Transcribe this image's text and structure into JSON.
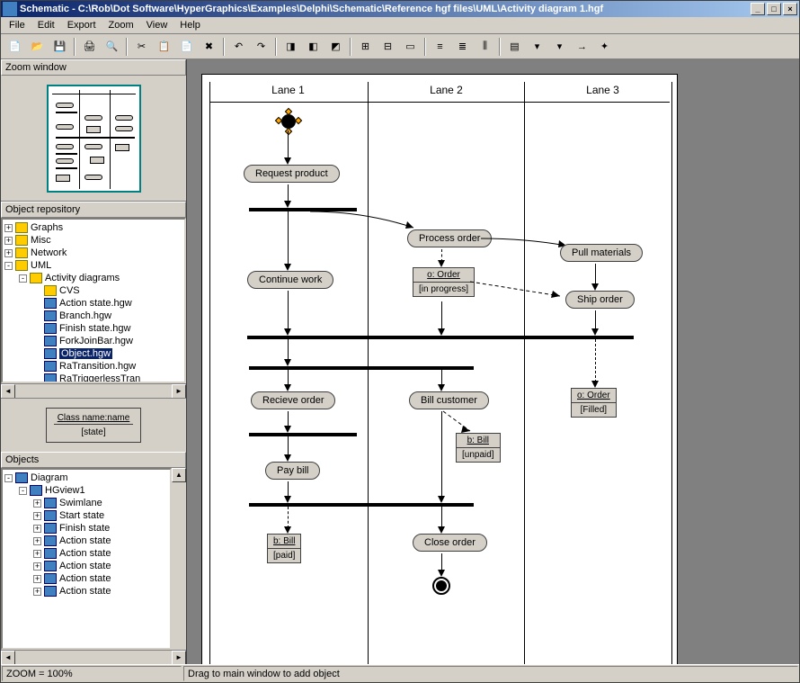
{
  "window": {
    "title": "Schematic - C:\\Rob\\Dot Software\\HyperGraphics\\Examples\\Delphi\\Schematic\\Reference hgf files\\UML\\Activity diagram 1.hgf"
  },
  "menubar": {
    "items": [
      "File",
      "Edit",
      "Export",
      "Zoom",
      "View",
      "Help"
    ]
  },
  "panels": {
    "zoom_window": "Zoom window",
    "object_repository": "Object repository",
    "objects": "Objects"
  },
  "repo_tree": {
    "items": [
      {
        "indent": 0,
        "toggle": "+",
        "type": "folder",
        "label": "Graphs"
      },
      {
        "indent": 0,
        "toggle": "+",
        "type": "folder",
        "label": "Misc"
      },
      {
        "indent": 0,
        "toggle": "+",
        "type": "folder",
        "label": "Network"
      },
      {
        "indent": 0,
        "toggle": "-",
        "type": "folder",
        "label": "UML"
      },
      {
        "indent": 1,
        "toggle": "-",
        "type": "folder",
        "label": "Activity diagrams"
      },
      {
        "indent": 2,
        "toggle": "",
        "type": "folder",
        "label": "CVS"
      },
      {
        "indent": 2,
        "toggle": "",
        "type": "file",
        "label": "Action state.hgw"
      },
      {
        "indent": 2,
        "toggle": "",
        "type": "file",
        "label": "Branch.hgw"
      },
      {
        "indent": 2,
        "toggle": "",
        "type": "file",
        "label": "Finish state.hgw"
      },
      {
        "indent": 2,
        "toggle": "",
        "type": "file",
        "label": "ForkJoinBar.hgw"
      },
      {
        "indent": 2,
        "toggle": "",
        "type": "file",
        "label": "Object.hgw",
        "selected": true
      },
      {
        "indent": 2,
        "toggle": "",
        "type": "file",
        "label": "RaTransition.hgw"
      },
      {
        "indent": 2,
        "toggle": "",
        "type": "file",
        "label": "RaTriggerlessTran"
      }
    ]
  },
  "preview": {
    "class_label": "Class name:name",
    "state_label": "[state]"
  },
  "objects_tree": {
    "items": [
      {
        "indent": 0,
        "toggle": "-",
        "type": "file",
        "label": "Diagram"
      },
      {
        "indent": 1,
        "toggle": "-",
        "type": "file",
        "label": "HGview1"
      },
      {
        "indent": 2,
        "toggle": "+",
        "type": "file",
        "label": "Swimlane"
      },
      {
        "indent": 2,
        "toggle": "+",
        "type": "file",
        "label": "Start state"
      },
      {
        "indent": 2,
        "toggle": "+",
        "type": "file",
        "label": "Finish state"
      },
      {
        "indent": 2,
        "toggle": "+",
        "type": "file",
        "label": "Action state"
      },
      {
        "indent": 2,
        "toggle": "+",
        "type": "file",
        "label": "Action state"
      },
      {
        "indent": 2,
        "toggle": "+",
        "type": "file",
        "label": "Action state"
      },
      {
        "indent": 2,
        "toggle": "+",
        "type": "file",
        "label": "Action state"
      },
      {
        "indent": 2,
        "toggle": "+",
        "type": "file",
        "label": "Action state"
      }
    ]
  },
  "diagram": {
    "lanes": [
      "Lane 1",
      "Lane 2",
      "Lane 3"
    ],
    "activities": {
      "request_product": "Request product",
      "continue_work": "Continue work",
      "process_order": "Process order",
      "pull_materials": "Pull materials",
      "ship_order": "Ship order",
      "recieve_order": "Recieve order",
      "bill_customer": "Bill customer",
      "pay_bill": "Pay bill",
      "close_order": "Close order"
    },
    "objects": {
      "order_progress": {
        "name": "o: Order",
        "state": "[in progress]"
      },
      "order_filled": {
        "name": "o: Order",
        "state": "[Filled]"
      },
      "bill_unpaid": {
        "name": "b: Bill",
        "state": "[unpaid]"
      },
      "bill_paid": {
        "name": "b: Bill",
        "state": "[paid]"
      }
    }
  },
  "statusbar": {
    "zoom": "ZOOM = 100%",
    "hint": "Drag to main window to add object"
  }
}
